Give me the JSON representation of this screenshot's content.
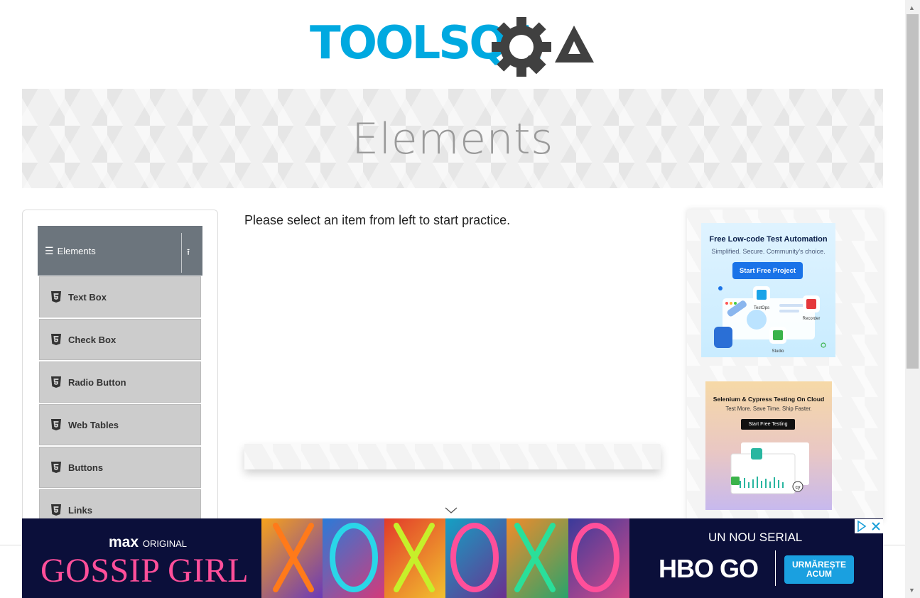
{
  "header": {
    "logo_text": "TOOLSQA"
  },
  "banner": {
    "title": "Elements"
  },
  "sidebar": {
    "group_label": "Elements",
    "items": [
      {
        "label": "Text Box"
      },
      {
        "label": "Check Box"
      },
      {
        "label": "Radio Button"
      },
      {
        "label": "Web Tables"
      },
      {
        "label": "Buttons"
      },
      {
        "label": "Links"
      }
    ]
  },
  "main": {
    "prompt": "Please select an item from left to start practice."
  },
  "ads": {
    "ad1": {
      "headline": "Free Low-code Test Automation",
      "sub": "Simplified. Secure. Community's choice.",
      "button": "Start Free Project",
      "labels": [
        "TestOps",
        "Recorder",
        "Studio"
      ]
    },
    "ad2": {
      "headline": "Selenium & Cypress Testing On Cloud",
      "sub": "Test More. Save Time. Ship Faster.",
      "button": "Start Free Testing"
    },
    "bottom": {
      "brand": "max",
      "brand_suffix": "ORIGINAL",
      "show": "GOSSIP GIRL",
      "serial": "UN NOU SERIAL",
      "network": "HBO GO",
      "cta": "URMĂREȘTE ACUM"
    }
  },
  "colors": {
    "logo_blue": "#00a9e0",
    "logo_dark": "#404040",
    "sidebar_header": "#6c757d",
    "menu_item_bg": "#cccccc",
    "bottom_ad_bg": "#0b0f3a",
    "show_pink": "#ff4f9a"
  }
}
